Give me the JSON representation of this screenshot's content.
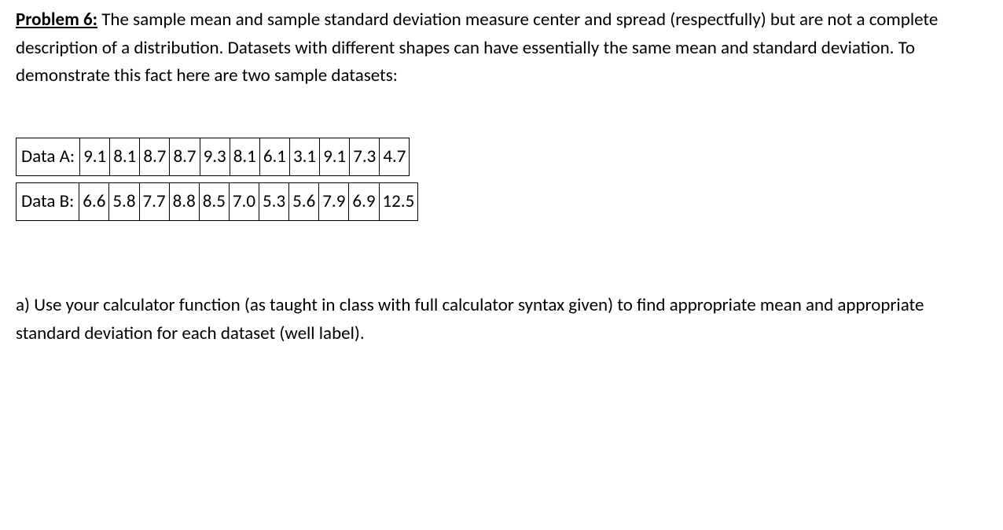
{
  "problem": {
    "label": "Problem 6:",
    "intro": "The sample mean and sample standard deviation measure center and spread (respectfully) but are not a complete description of a distribution.  Datasets with different shapes can have essentially the same mean and standard deviation.  To demonstrate this fact here are two sample datasets:"
  },
  "tables": {
    "rowA": {
      "label": "Data A:",
      "values": [
        "9.1",
        "8.1",
        "8.7",
        "8.7",
        "9.3",
        "8.1",
        "6.1",
        "3.1",
        "9.1",
        "7.3",
        "4.7"
      ]
    },
    "rowB": {
      "label": "Data B:",
      "values": [
        "6.6",
        "5.8",
        "7.7",
        "8.8",
        "8.5",
        "7.0",
        "5.3",
        "5.6",
        "7.9",
        "6.9",
        "12.5"
      ]
    }
  },
  "question_a": "a) Use your calculator function (as taught in class with full calculator syntax given) to find appropriate mean and appropriate standard deviation for each dataset (well label)."
}
